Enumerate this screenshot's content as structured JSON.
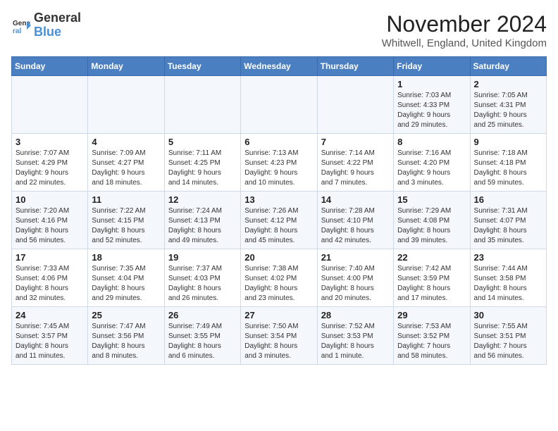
{
  "header": {
    "logo_line1": "General",
    "logo_line2": "Blue",
    "month_title": "November 2024",
    "location": "Whitwell, England, United Kingdom"
  },
  "days_of_week": [
    "Sunday",
    "Monday",
    "Tuesday",
    "Wednesday",
    "Thursday",
    "Friday",
    "Saturday"
  ],
  "weeks": [
    [
      {
        "day": "",
        "info": ""
      },
      {
        "day": "",
        "info": ""
      },
      {
        "day": "",
        "info": ""
      },
      {
        "day": "",
        "info": ""
      },
      {
        "day": "",
        "info": ""
      },
      {
        "day": "1",
        "info": "Sunrise: 7:03 AM\nSunset: 4:33 PM\nDaylight: 9 hours\nand 29 minutes."
      },
      {
        "day": "2",
        "info": "Sunrise: 7:05 AM\nSunset: 4:31 PM\nDaylight: 9 hours\nand 25 minutes."
      }
    ],
    [
      {
        "day": "3",
        "info": "Sunrise: 7:07 AM\nSunset: 4:29 PM\nDaylight: 9 hours\nand 22 minutes."
      },
      {
        "day": "4",
        "info": "Sunrise: 7:09 AM\nSunset: 4:27 PM\nDaylight: 9 hours\nand 18 minutes."
      },
      {
        "day": "5",
        "info": "Sunrise: 7:11 AM\nSunset: 4:25 PM\nDaylight: 9 hours\nand 14 minutes."
      },
      {
        "day": "6",
        "info": "Sunrise: 7:13 AM\nSunset: 4:23 PM\nDaylight: 9 hours\nand 10 minutes."
      },
      {
        "day": "7",
        "info": "Sunrise: 7:14 AM\nSunset: 4:22 PM\nDaylight: 9 hours\nand 7 minutes."
      },
      {
        "day": "8",
        "info": "Sunrise: 7:16 AM\nSunset: 4:20 PM\nDaylight: 9 hours\nand 3 minutes."
      },
      {
        "day": "9",
        "info": "Sunrise: 7:18 AM\nSunset: 4:18 PM\nDaylight: 8 hours\nand 59 minutes."
      }
    ],
    [
      {
        "day": "10",
        "info": "Sunrise: 7:20 AM\nSunset: 4:16 PM\nDaylight: 8 hours\nand 56 minutes."
      },
      {
        "day": "11",
        "info": "Sunrise: 7:22 AM\nSunset: 4:15 PM\nDaylight: 8 hours\nand 52 minutes."
      },
      {
        "day": "12",
        "info": "Sunrise: 7:24 AM\nSunset: 4:13 PM\nDaylight: 8 hours\nand 49 minutes."
      },
      {
        "day": "13",
        "info": "Sunrise: 7:26 AM\nSunset: 4:12 PM\nDaylight: 8 hours\nand 45 minutes."
      },
      {
        "day": "14",
        "info": "Sunrise: 7:28 AM\nSunset: 4:10 PM\nDaylight: 8 hours\nand 42 minutes."
      },
      {
        "day": "15",
        "info": "Sunrise: 7:29 AM\nSunset: 4:08 PM\nDaylight: 8 hours\nand 39 minutes."
      },
      {
        "day": "16",
        "info": "Sunrise: 7:31 AM\nSunset: 4:07 PM\nDaylight: 8 hours\nand 35 minutes."
      }
    ],
    [
      {
        "day": "17",
        "info": "Sunrise: 7:33 AM\nSunset: 4:06 PM\nDaylight: 8 hours\nand 32 minutes."
      },
      {
        "day": "18",
        "info": "Sunrise: 7:35 AM\nSunset: 4:04 PM\nDaylight: 8 hours\nand 29 minutes."
      },
      {
        "day": "19",
        "info": "Sunrise: 7:37 AM\nSunset: 4:03 PM\nDaylight: 8 hours\nand 26 minutes."
      },
      {
        "day": "20",
        "info": "Sunrise: 7:38 AM\nSunset: 4:02 PM\nDaylight: 8 hours\nand 23 minutes."
      },
      {
        "day": "21",
        "info": "Sunrise: 7:40 AM\nSunset: 4:00 PM\nDaylight: 8 hours\nand 20 minutes."
      },
      {
        "day": "22",
        "info": "Sunrise: 7:42 AM\nSunset: 3:59 PM\nDaylight: 8 hours\nand 17 minutes."
      },
      {
        "day": "23",
        "info": "Sunrise: 7:44 AM\nSunset: 3:58 PM\nDaylight: 8 hours\nand 14 minutes."
      }
    ],
    [
      {
        "day": "24",
        "info": "Sunrise: 7:45 AM\nSunset: 3:57 PM\nDaylight: 8 hours\nand 11 minutes."
      },
      {
        "day": "25",
        "info": "Sunrise: 7:47 AM\nSunset: 3:56 PM\nDaylight: 8 hours\nand 8 minutes."
      },
      {
        "day": "26",
        "info": "Sunrise: 7:49 AM\nSunset: 3:55 PM\nDaylight: 8 hours\nand 6 minutes."
      },
      {
        "day": "27",
        "info": "Sunrise: 7:50 AM\nSunset: 3:54 PM\nDaylight: 8 hours\nand 3 minutes."
      },
      {
        "day": "28",
        "info": "Sunrise: 7:52 AM\nSunset: 3:53 PM\nDaylight: 8 hours\nand 1 minute."
      },
      {
        "day": "29",
        "info": "Sunrise: 7:53 AM\nSunset: 3:52 PM\nDaylight: 7 hours\nand 58 minutes."
      },
      {
        "day": "30",
        "info": "Sunrise: 7:55 AM\nSunset: 3:51 PM\nDaylight: 7 hours\nand 56 minutes."
      }
    ]
  ]
}
